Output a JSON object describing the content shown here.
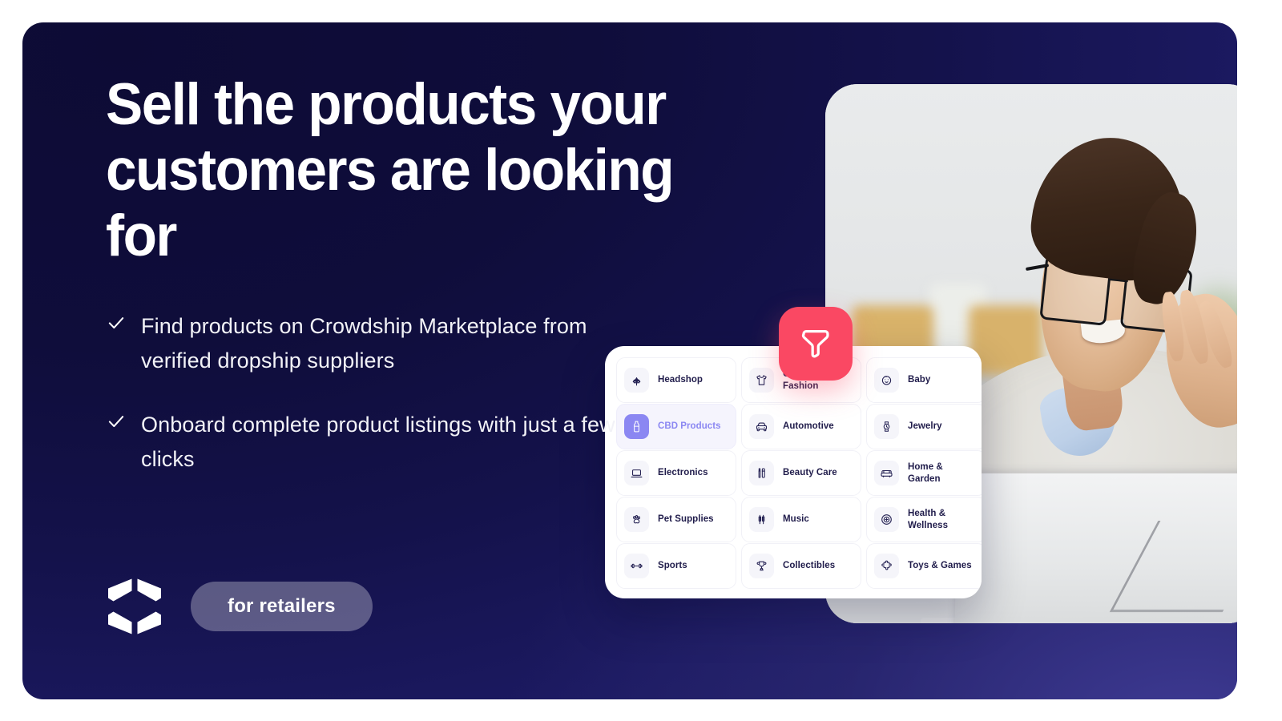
{
  "hero": {
    "headline": "Sell the  products your customers are looking for",
    "bullets": [
      "Find products on Crowdship Marketplace from verified dropship suppliers",
      "Onboard complete product listings with just a few clicks"
    ],
    "pill_label": "for retailers",
    "logo_name": "crowdship-logo"
  },
  "colors": {
    "background_dark": "#0d0b35",
    "background_light": "#2b2974",
    "accent_red": "#fa4863",
    "accent_purple": "#8b87f2",
    "text_primary": "#ffffff",
    "category_text": "#201c4b",
    "panel_background": "#ffffff"
  },
  "filter_badge": {
    "icon": "filter-funnel-icon"
  },
  "photo": {
    "alt": "Smiling man wearing glasses working at a laptop"
  },
  "categories": {
    "items": [
      {
        "label": "Headshop",
        "icon": "cannabis-leaf-icon",
        "active": false
      },
      {
        "label": "Clothing &\nFashion",
        "icon": "t-shirt-icon",
        "active": false
      },
      {
        "label": "Baby",
        "icon": "baby-face-icon",
        "active": false
      },
      {
        "label": "CBD Products",
        "icon": "bottle-icon",
        "active": true
      },
      {
        "label": "Automotive",
        "icon": "car-icon",
        "active": false
      },
      {
        "label": "Jewelry",
        "icon": "watch-icon",
        "active": false
      },
      {
        "label": "Electronics",
        "icon": "laptop-icon",
        "active": false
      },
      {
        "label": "Beauty Care",
        "icon": "cosmetics-icon",
        "active": false
      },
      {
        "label": "Home &\nGarden",
        "icon": "sofa-icon",
        "active": false
      },
      {
        "label": "Pet Supplies",
        "icon": "paw-icon",
        "active": false
      },
      {
        "label": "Music",
        "icon": "earbuds-icon",
        "active": false
      },
      {
        "label": "Health &\nWellness",
        "icon": "health-circle-icon",
        "active": false
      },
      {
        "label": "Sports",
        "icon": "dumbbell-icon",
        "active": false
      },
      {
        "label": "Collectibles",
        "icon": "trophy-icon",
        "active": false
      },
      {
        "label": "Toys & Games",
        "icon": "puzzle-piece-icon",
        "active": false
      }
    ]
  }
}
